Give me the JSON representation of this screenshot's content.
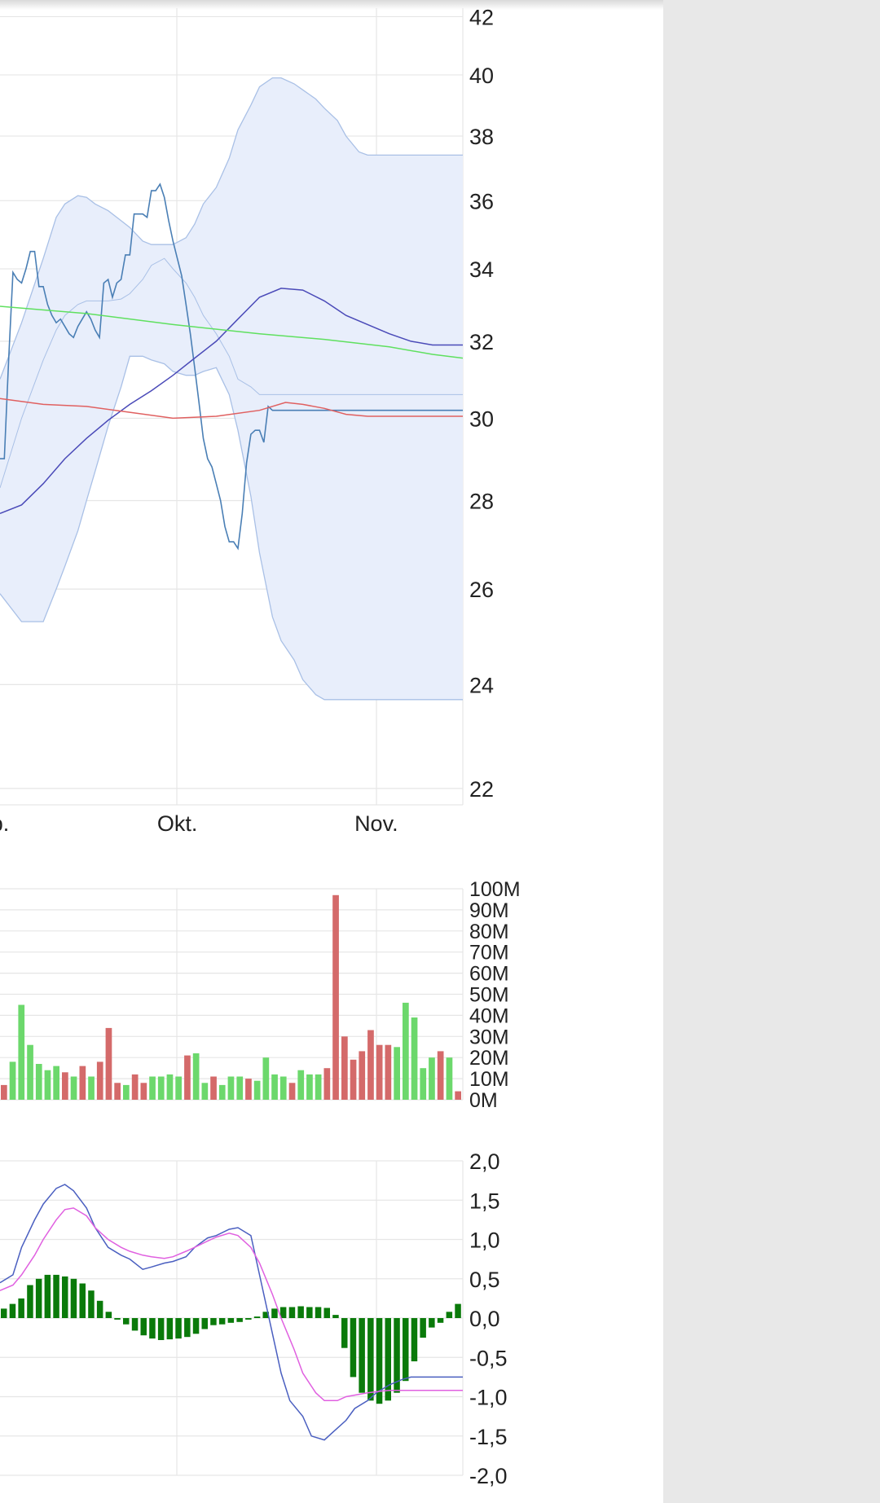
{
  "colors": {
    "price": "#4a7fb5",
    "band_fill": "#e8eefb",
    "band_stroke": "#a9c0e6",
    "ma_blue": "#4a4ab8",
    "ma_green": "#5fe05f",
    "ma_red": "#e06060",
    "vol_up": "#6cd86c",
    "vol_down": "#d46a6a",
    "macd_line": "#4a5fc0",
    "macd_signal": "#e060e0",
    "macd_hist": "#0a7a0a",
    "grid": "#e6e6e6",
    "panel_bg": "#e8e8e8"
  },
  "chart_data": [
    {
      "type": "line",
      "panel": "price",
      "y_ticks": [
        42,
        40,
        38,
        36,
        34,
        32,
        30,
        28,
        26,
        24,
        22
      ],
      "y_tick_labels": [
        "42",
        "40",
        "38",
        "36",
        "34",
        "32",
        "30",
        "28",
        "26",
        "24",
        "22"
      ],
      "x_tick_labels": [
        {
          "label": "p.",
          "x": 0
        },
        {
          "label": "Okt.",
          "x": 41
        },
        {
          "label": "Nov.",
          "x": 87
        }
      ],
      "x_range": [
        0,
        107
      ],
      "ylim": [
        21.7,
        42.3
      ],
      "log_scale": true,
      "series": [
        {
          "key": "price",
          "x": [
            0,
            1,
            2,
            3,
            4,
            5,
            6,
            7,
            8,
            9,
            10,
            11,
            12,
            13,
            14,
            15,
            16,
            17,
            18,
            19,
            20,
            21,
            22,
            23,
            24,
            25,
            26,
            27,
            28,
            29,
            30,
            31,
            32,
            33,
            34,
            35,
            36,
            37,
            38,
            39,
            40,
            41,
            42,
            43,
            44,
            45,
            46,
            47,
            48,
            49,
            50,
            51,
            52,
            53,
            54,
            55,
            56,
            57,
            58,
            59,
            60,
            61,
            62,
            63,
            64,
            65,
            66,
            67,
            68,
            69,
            70,
            71,
            72,
            73,
            74,
            75,
            76,
            77,
            78,
            79,
            80,
            81,
            82,
            83,
            84,
            85,
            86,
            87,
            88,
            89,
            90,
            91,
            92,
            93,
            94,
            95,
            96,
            97,
            98,
            99,
            100,
            101,
            102,
            103,
            104,
            105,
            106,
            107
          ],
          "values": [
            29.0,
            29.0,
            31.5,
            33.9,
            33.7,
            33.6,
            34.0,
            34.5,
            34.5,
            33.5,
            33.5,
            33.0,
            32.7,
            32.5,
            32.6,
            32.4,
            32.2,
            32.1,
            32.4,
            32.6,
            32.8,
            32.6,
            32.3,
            32.1,
            33.6,
            33.7,
            33.2,
            33.6,
            33.7,
            34.4,
            34.4,
            35.6,
            35.6,
            35.6,
            35.5,
            36.3,
            36.3,
            36.5,
            36.1,
            35.4,
            34.8,
            34.3,
            33.8,
            33.0,
            32.2,
            31.3,
            30.4,
            29.5,
            29.0,
            28.8,
            28.4,
            28.0,
            27.4,
            27.05,
            27.05,
            26.9,
            27.7,
            28.9,
            29.6,
            29.7,
            29.7,
            29.4,
            30.3,
            30.2,
            30.2,
            30.2,
            30.2,
            30.2,
            30.2,
            30.2,
            30.2,
            30.2,
            30.2,
            30.2,
            30.2,
            30.2,
            30.2,
            30.2,
            30.2,
            30.2,
            30.2,
            30.2,
            30.2,
            30.2,
            30.2,
            30.2,
            30.2,
            30.2,
            30.2,
            30.2,
            30.2,
            30.2,
            30.2,
            30.2,
            30.2,
            30.2,
            30.2,
            30.2,
            30.2,
            30.2,
            30.2,
            30.2,
            30.2,
            30.2,
            30.2,
            30.2,
            30.2,
            30.2
          ]
        },
        {
          "key": "ma_blue",
          "x": [
            0,
            5,
            10,
            15,
            20,
            25,
            30,
            35,
            40,
            45,
            50,
            55,
            60,
            65,
            70,
            75,
            80,
            85,
            90,
            95,
            100,
            105,
            107
          ],
          "values": [
            27.7,
            27.9,
            28.4,
            29.0,
            29.5,
            29.95,
            30.35,
            30.7,
            31.1,
            31.55,
            32.0,
            32.6,
            33.2,
            33.45,
            33.4,
            33.1,
            32.7,
            32.45,
            32.2,
            32.0,
            31.9,
            31.9,
            31.9
          ]
        },
        {
          "key": "ma_green",
          "x": [
            0,
            20,
            40,
            60,
            75,
            90,
            100,
            107
          ],
          "values": [
            32.95,
            32.75,
            32.45,
            32.2,
            32.05,
            31.85,
            31.65,
            31.55
          ]
        },
        {
          "key": "ma_red",
          "x": [
            0,
            10,
            20,
            30,
            40,
            50,
            60,
            66,
            70,
            75,
            80,
            85,
            90,
            95,
            100,
            107
          ],
          "values": [
            30.5,
            30.35,
            30.3,
            30.15,
            30.0,
            30.05,
            30.2,
            30.4,
            30.35,
            30.25,
            30.1,
            30.05,
            30.05,
            30.05,
            30.05,
            30.05
          ]
        }
      ],
      "bollinger": {
        "x": [
          0,
          5,
          10,
          13,
          15,
          18,
          20,
          22,
          25,
          28,
          30,
          33,
          35,
          38,
          40,
          43,
          45,
          47,
          50,
          53,
          55,
          58,
          60,
          63,
          65,
          68,
          70,
          73,
          75,
          78,
          80,
          83,
          85,
          88,
          90,
          93,
          95,
          98,
          100,
          103,
          105,
          107
        ],
        "upper": [
          31.0,
          32.5,
          34.3,
          35.5,
          35.9,
          36.15,
          36.1,
          35.9,
          35.7,
          35.4,
          35.2,
          34.8,
          34.7,
          34.7,
          34.7,
          34.9,
          35.3,
          35.9,
          36.4,
          37.3,
          38.2,
          39.0,
          39.6,
          39.9,
          39.9,
          39.7,
          39.5,
          39.2,
          38.9,
          38.5,
          38.0,
          37.5,
          37.4,
          37.4,
          37.4,
          37.4,
          37.4,
          37.4,
          37.4,
          37.4,
          37.4,
          37.4
        ],
        "middle": [
          28.3,
          30.0,
          31.5,
          32.3,
          32.7,
          33.0,
          33.1,
          33.1,
          33.1,
          33.15,
          33.3,
          33.7,
          34.1,
          34.3,
          34.0,
          33.6,
          33.2,
          32.7,
          32.2,
          31.6,
          31.0,
          30.8,
          30.6,
          30.6,
          30.6,
          30.6,
          30.6,
          30.6,
          30.6,
          30.6,
          30.6,
          30.6,
          30.6,
          30.6,
          30.6,
          30.6,
          30.6,
          30.6,
          30.6,
          30.6,
          30.6,
          30.6
        ],
        "lower": [
          25.9,
          25.3,
          25.3,
          26.0,
          26.5,
          27.3,
          28.0,
          28.7,
          29.8,
          30.8,
          31.6,
          31.6,
          31.5,
          31.4,
          31.2,
          31.1,
          31.1,
          31.2,
          31.3,
          30.6,
          29.7,
          28.1,
          26.8,
          25.4,
          24.9,
          24.5,
          24.1,
          23.8,
          23.7,
          23.7,
          23.7,
          23.7,
          23.7,
          23.7,
          23.7,
          23.7,
          23.7,
          23.7,
          23.7,
          23.7,
          23.7,
          23.7
        ]
      }
    },
    {
      "type": "bar",
      "panel": "volume",
      "y_tick_labels": [
        "100M",
        "90M",
        "80M",
        "70M",
        "60M",
        "50M",
        "40M",
        "30M",
        "20M",
        "10M",
        "0M"
      ],
      "ylim": [
        0,
        100
      ],
      "unit": "M",
      "values": [
        7,
        18,
        45,
        26,
        17,
        14,
        16,
        13,
        11,
        16,
        11,
        18,
        34,
        8,
        7,
        12,
        8,
        11,
        11,
        12,
        11,
        21,
        22,
        8,
        11,
        7,
        11,
        11,
        10,
        9,
        20,
        12,
        11,
        8,
        14,
        12,
        12,
        15,
        97,
        30,
        19,
        23,
        33,
        26,
        26,
        25,
        46,
        39,
        15,
        20,
        23,
        20,
        4
      ],
      "directions": [
        "d",
        "u",
        "u",
        "u",
        "u",
        "u",
        "u",
        "d",
        "u",
        "d",
        "u",
        "d",
        "d",
        "d",
        "u",
        "d",
        "d",
        "u",
        "u",
        "u",
        "u",
        "d",
        "u",
        "u",
        "d",
        "u",
        "u",
        "u",
        "d",
        "u",
        "u",
        "u",
        "u",
        "d",
        "u",
        "u",
        "u",
        "d",
        "d",
        "d",
        "d",
        "d",
        "d",
        "d",
        "d",
        "u",
        "u",
        "u",
        "u",
        "u",
        "d",
        "u",
        "d"
      ]
    },
    {
      "type": "line",
      "panel": "macd",
      "y_tick_labels": [
        "2,0",
        "1,5",
        "1,0",
        "0,5",
        "0,0",
        "-0,5",
        "-1,0",
        "-1,5",
        "-2,0"
      ],
      "ylim": [
        -2.0,
        2.0
      ],
      "series": [
        {
          "key": "macd_line",
          "x": [
            0,
            3,
            5,
            8,
            10,
            13,
            15,
            17,
            20,
            22,
            25,
            28,
            30,
            33,
            35,
            38,
            40,
            43,
            45,
            48,
            50,
            53,
            55,
            58,
            60,
            63,
            65,
            67,
            70,
            72,
            75,
            77,
            80,
            82,
            85,
            87,
            90,
            93,
            95,
            98,
            100,
            103,
            105,
            107
          ],
          "values": [
            0.45,
            0.55,
            0.9,
            1.25,
            1.45,
            1.65,
            1.7,
            1.62,
            1.4,
            1.15,
            0.9,
            0.8,
            0.75,
            0.62,
            0.65,
            0.7,
            0.72,
            0.78,
            0.9,
            1.02,
            1.05,
            1.13,
            1.15,
            1.05,
            0.55,
            -0.2,
            -0.7,
            -1.05,
            -1.25,
            -1.5,
            -1.55,
            -1.45,
            -1.3,
            -1.15,
            -1.05,
            -0.95,
            -0.85,
            -0.78,
            -0.75,
            -0.75,
            -0.75,
            -0.75,
            -0.75,
            -0.75
          ]
        },
        {
          "key": "macd_signal",
          "x": [
            0,
            3,
            5,
            8,
            10,
            13,
            15,
            17,
            20,
            22,
            25,
            28,
            30,
            33,
            35,
            38,
            40,
            43,
            45,
            48,
            50,
            53,
            55,
            58,
            60,
            63,
            65,
            68,
            70,
            73,
            75,
            78,
            80,
            83,
            85,
            88,
            90,
            93,
            95,
            98,
            100,
            103,
            105,
            107
          ],
          "values": [
            0.35,
            0.42,
            0.55,
            0.8,
            1.0,
            1.25,
            1.38,
            1.4,
            1.3,
            1.15,
            1.0,
            0.9,
            0.85,
            0.8,
            0.78,
            0.76,
            0.78,
            0.85,
            0.9,
            0.98,
            1.03,
            1.08,
            1.05,
            0.9,
            0.7,
            0.3,
            0.0,
            -0.4,
            -0.7,
            -0.95,
            -1.05,
            -1.05,
            -1.0,
            -0.97,
            -0.95,
            -0.93,
            -0.92,
            -0.92,
            -0.92,
            -0.92,
            -0.92,
            -0.92,
            -0.92,
            -0.92
          ]
        }
      ],
      "histogram": [
        0.12,
        0.18,
        0.25,
        0.42,
        0.5,
        0.55,
        0.55,
        0.53,
        0.5,
        0.44,
        0.35,
        0.22,
        0.08,
        -0.02,
        -0.08,
        -0.16,
        -0.22,
        -0.26,
        -0.28,
        -0.27,
        -0.26,
        -0.24,
        -0.2,
        -0.14,
        -0.09,
        -0.08,
        -0.06,
        -0.05,
        -0.02,
        0.02,
        0.08,
        0.12,
        0.14,
        0.14,
        0.15,
        0.14,
        0.14,
        0.13,
        0.04,
        -0.38,
        -0.75,
        -0.95,
        -1.05,
        -1.09,
        -1.05,
        -0.95,
        -0.8,
        -0.55,
        -0.25,
        -0.12,
        -0.06,
        0.08,
        0.18
      ]
    }
  ]
}
